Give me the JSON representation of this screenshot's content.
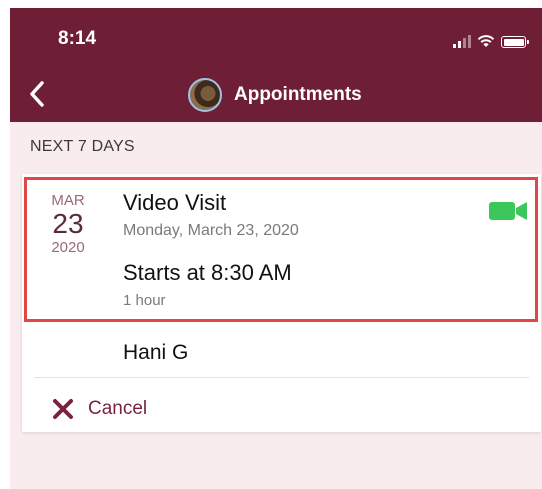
{
  "status_bar": {
    "time": "8:14"
  },
  "header": {
    "title": "Appointments"
  },
  "section": {
    "label": "NEXT 7 DAYS"
  },
  "appointment": {
    "month": "MAR",
    "day": "23",
    "year": "2020",
    "visit_type": "Video Visit",
    "full_date": "Monday, March 23, 2020",
    "start_time": "Starts at 8:30 AM",
    "duration": "1 hour",
    "provider": "Hani G",
    "cancel_label": "Cancel"
  },
  "colors": {
    "header_bg": "#6e1e35",
    "page_bg": "#f9ecee",
    "highlight_border": "#e04848",
    "video_icon": "#3cc75a",
    "cancel_accent": "#7a2340"
  },
  "icons": {
    "back": "chevron-left-icon",
    "video": "video-camera-icon",
    "cancel": "close-icon",
    "signal": "signal-icon",
    "wifi": "wifi-icon",
    "battery": "battery-icon"
  }
}
